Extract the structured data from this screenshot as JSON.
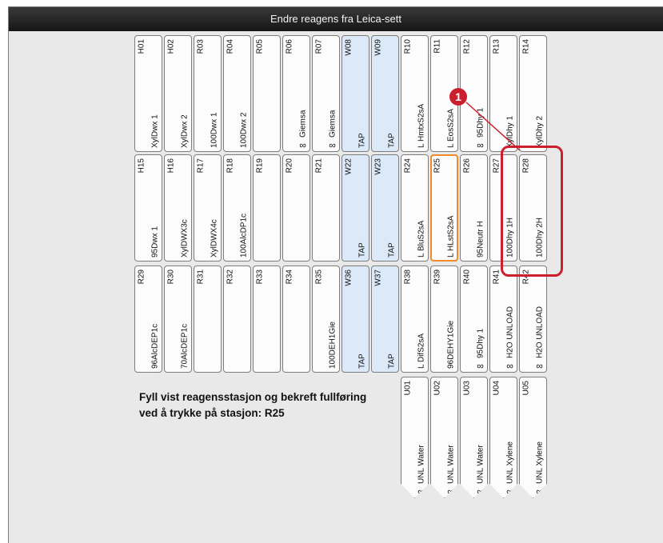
{
  "window": {
    "title": "Endre reagens fra Leica-sett"
  },
  "rows": [
    [
      {
        "code": "H01",
        "reagent": "XylDwx 1"
      },
      {
        "code": "H02",
        "reagent": "XylDwx 2"
      },
      {
        "code": "R03",
        "reagent": "100Dwx 1"
      },
      {
        "code": "R04",
        "reagent": "100Dwx 2"
      },
      {
        "code": "R05",
        "reagent": ""
      },
      {
        "code": "R06",
        "reagent": "Giemsa",
        "inf": "∞"
      },
      {
        "code": "R07",
        "reagent": "Giemsa",
        "inf": "∞"
      },
      {
        "code": "W08",
        "reagent": "TAP",
        "water": true
      },
      {
        "code": "W09",
        "reagent": "TAP",
        "water": true
      },
      {
        "code": "R10",
        "reagent": "L HmtxS2sA"
      },
      {
        "code": "R11",
        "reagent": "L EosS2sA"
      },
      {
        "code": "R12",
        "reagent": "95Dhy 1",
        "inf": "∞"
      },
      {
        "code": "R13",
        "reagent": "XylDhy 1"
      },
      {
        "code": "R14",
        "reagent": "XylDhy 2"
      }
    ],
    [
      {
        "code": "H15",
        "reagent": "95Dwx 1"
      },
      {
        "code": "H16",
        "reagent": "XylDWX3c"
      },
      {
        "code": "R17",
        "reagent": "XylDWX4c"
      },
      {
        "code": "R18",
        "reagent": "100AlcDP1c"
      },
      {
        "code": "R19",
        "reagent": ""
      },
      {
        "code": "R20",
        "reagent": ""
      },
      {
        "code": "R21",
        "reagent": ""
      },
      {
        "code": "W22",
        "reagent": "TAP",
        "water": true
      },
      {
        "code": "W23",
        "reagent": "TAP",
        "water": true
      },
      {
        "code": "R24",
        "reagent": "L BluS2sA"
      },
      {
        "code": "R25",
        "reagent": "L HLstS2sA",
        "selected": true
      },
      {
        "code": "R26",
        "reagent": "95Neutr H"
      },
      {
        "code": "R27",
        "reagent": "100Dhy 1H"
      },
      {
        "code": "R28",
        "reagent": "100Dhy 2H"
      }
    ],
    [
      {
        "code": "R29",
        "reagent": "96AlcDEP1c"
      },
      {
        "code": "R30",
        "reagent": "70AlcDEP1c"
      },
      {
        "code": "R31",
        "reagent": ""
      },
      {
        "code": "R32",
        "reagent": ""
      },
      {
        "code": "R33",
        "reagent": ""
      },
      {
        "code": "R34",
        "reagent": ""
      },
      {
        "code": "R35",
        "reagent": "100DEH1Gie"
      },
      {
        "code": "W36",
        "reagent": "TAP",
        "water": true
      },
      {
        "code": "W37",
        "reagent": "TAP",
        "water": true
      },
      {
        "code": "R38",
        "reagent": "L DifS2sA"
      },
      {
        "code": "R39",
        "reagent": "96DEHY1Gie"
      },
      {
        "code": "R40",
        "reagent": "95Dhy 1",
        "inf": "∞"
      },
      {
        "code": "R41",
        "reagent": "H2O UNLOAD",
        "inf": "∞"
      },
      {
        "code": "R42",
        "reagent": "H2O UNLOAD",
        "inf": "∞"
      }
    ]
  ],
  "slots": [
    {
      "code": "U01",
      "reagent": "UNL Water",
      "inf": "∞"
    },
    {
      "code": "U02",
      "reagent": "UNL Water",
      "inf": "∞"
    },
    {
      "code": "U03",
      "reagent": "UNL Water",
      "inf": "∞"
    },
    {
      "code": "U04",
      "reagent": "UNL Xylene",
      "inf": "∞"
    },
    {
      "code": "U05",
      "reagent": "UNL Xylene",
      "inf": "∞"
    }
  ],
  "instruction": {
    "line1": "Fyll vist reagensstasjon og bekreft fullføring",
    "line2": "ved å trykke på stasjon: R25"
  },
  "callout": {
    "number": "1"
  },
  "colors": {
    "selected": "#f08a2a",
    "callout": "#cc1f2d",
    "water": "#dce9f8"
  }
}
